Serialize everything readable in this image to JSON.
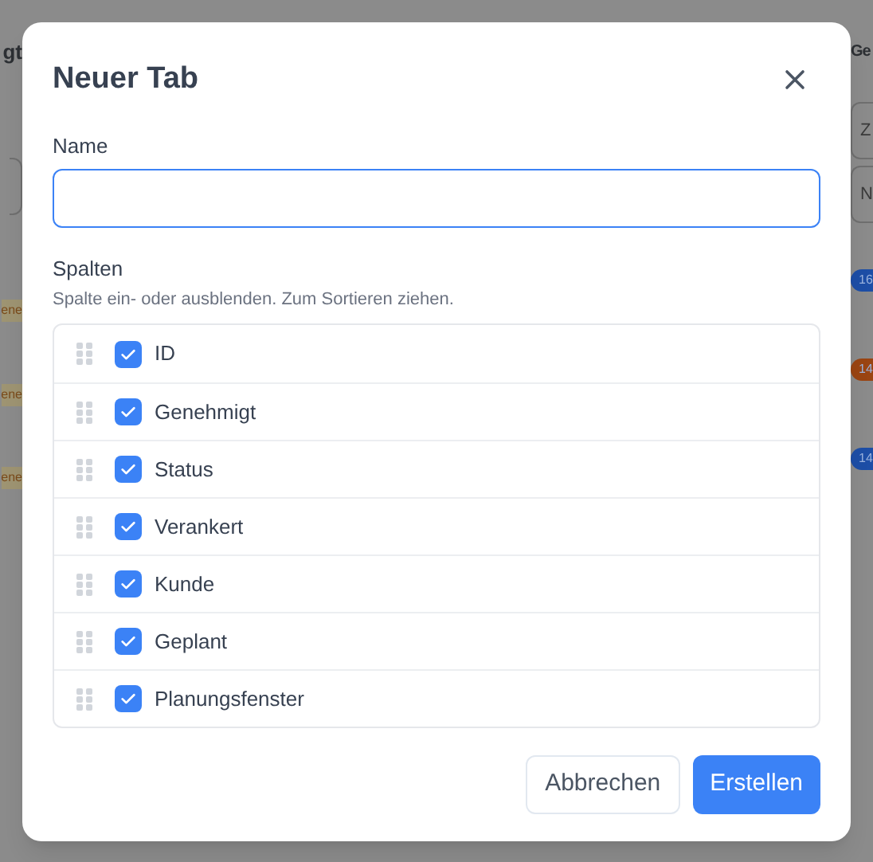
{
  "background": {
    "left_column": {
      "header": "gt",
      "badges": [
        "ene",
        "ene",
        "ene"
      ]
    },
    "right_column": {
      "header": "Ge",
      "fields": [
        "Z",
        "N"
      ],
      "badges": [
        {
          "text": "16",
          "color": "#1d4ea6"
        },
        {
          "text": "14",
          "color": "#9a4412"
        },
        {
          "text": "14",
          "color": "#1d4ea6"
        }
      ]
    }
  },
  "dialog": {
    "title": "Neuer Tab",
    "name_field": {
      "label": "Name",
      "focused": true
    },
    "columns_section": {
      "label": "Spalten",
      "hint": "Spalte ein- oder ausblenden. Zum Sortieren ziehen.",
      "items": [
        {
          "label": "ID",
          "checked": true
        },
        {
          "label": "Genehmigt",
          "checked": true
        },
        {
          "label": "Status",
          "checked": true
        },
        {
          "label": "Verankert",
          "checked": true
        },
        {
          "label": "Kunde",
          "checked": true
        },
        {
          "label": "Geplant",
          "checked": true
        },
        {
          "label": "Planungsfenster",
          "checked": true
        }
      ]
    },
    "buttons": [
      {
        "label": "Abbrechen",
        "kind": "secondary"
      },
      {
        "label": "Erstellen",
        "kind": "primary"
      }
    ]
  }
}
